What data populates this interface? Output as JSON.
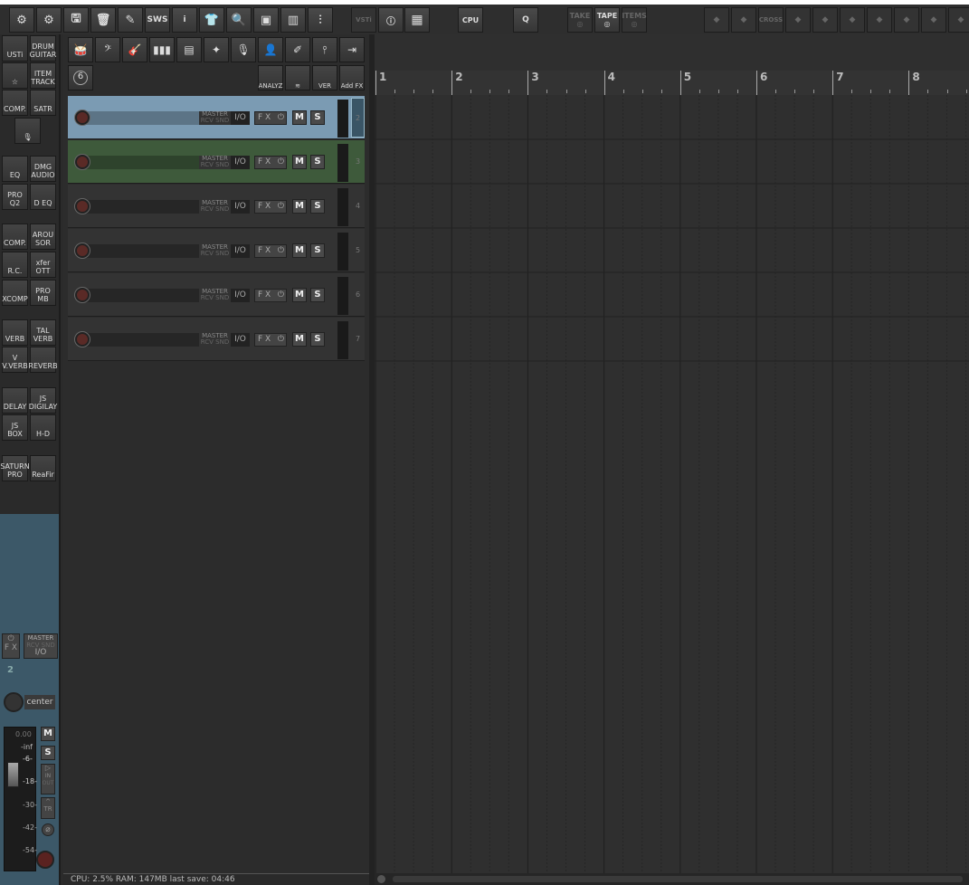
{
  "toolbar": {
    "main": [
      {
        "icon": "preferences-icon"
      },
      {
        "icon": "gear-icon"
      },
      {
        "icon": "save-icon"
      },
      {
        "icon": "trash-icon"
      },
      {
        "icon": "notes-icon"
      },
      {
        "icon": "sws-icon",
        "label": "SWS"
      },
      {
        "icon": "info-icon",
        "label": "i"
      },
      {
        "icon": "theme-icon"
      },
      {
        "icon": "search-icon"
      },
      {
        "icon": "window-icon"
      },
      {
        "icon": "spectrum-icon"
      },
      {
        "icon": "mixer-icon"
      }
    ],
    "vsti_label": "VSTi",
    "cpu_label": "CPU",
    "q_label": "Q",
    "take_label": "TAKE",
    "tape_label": "TAPE",
    "items_label": "ITEMS",
    "cross_label": "CROSS"
  },
  "sidebar": {
    "items": [
      {
        "top": "",
        "bottom": "USTi"
      },
      {
        "top": "DRUM",
        "bottom": "GUITAR"
      },
      {
        "top": "☆",
        "bottom": ""
      },
      {
        "top": "ITEM",
        "bottom": "TRACK"
      },
      {
        "top": "",
        "bottom": "COMP."
      },
      {
        "top": "",
        "bottom": "SATR"
      },
      {
        "top": "🎙",
        "bottom": ""
      },
      {
        "top": "",
        "bottom": "EQ"
      },
      {
        "top": "DMG",
        "bottom": "AUDIO"
      },
      {
        "top": "PRO",
        "bottom": "Q2"
      },
      {
        "top": "",
        "bottom": "D EQ"
      },
      {
        "top": "",
        "bottom": "COMP."
      },
      {
        "top": "AROU",
        "bottom": "SOR"
      },
      {
        "top": "",
        "bottom": "R.C."
      },
      {
        "top": "xfer",
        "bottom": "OTT"
      },
      {
        "top": "",
        "bottom": "XCOMP"
      },
      {
        "top": "PRO",
        "bottom": "MB"
      },
      {
        "top": "",
        "bottom": "VERB"
      },
      {
        "top": "TAL",
        "bottom": "VERB"
      },
      {
        "top": "V",
        "bottom": "V.VERB"
      },
      {
        "top": "",
        "bottom": "REVERB"
      },
      {
        "top": "",
        "bottom": "DELAY"
      },
      {
        "top": "JS",
        "bottom": "DIGILAY"
      },
      {
        "top": "JS",
        "bottom": "BOX"
      },
      {
        "top": "",
        "bottom": "H-D"
      },
      {
        "top": "SATURN",
        "bottom": "PRO"
      },
      {
        "top": "",
        "bottom": "ReaFir"
      }
    ]
  },
  "tcp_toolbar": {
    "icons": [
      "drums-icon",
      "bass-clef-icon",
      "guitar-icon",
      "piano-icon",
      "synth-icon",
      "fx-icon",
      "microphone-icon",
      "person-icon",
      "cable-icon",
      "eq-icon",
      "arrow-right-icon"
    ],
    "six_label": "6",
    "analyz_label": "ANALYZ",
    "ver_label": "VER",
    "addfx_label": "Add FX"
  },
  "tracks": [
    {
      "number": "2",
      "color": "#7b9bb3",
      "master": "MASTER",
      "rcvsnd": "RCV SND",
      "io": "I/O",
      "fx": "F X",
      "mute": "M",
      "solo": "S"
    },
    {
      "number": "3",
      "color": "#3e5a3b",
      "master": "MASTER",
      "rcvsnd": "RCV SND",
      "io": "I/O",
      "fx": "F X",
      "mute": "M",
      "solo": "S"
    },
    {
      "number": "4",
      "color": "#333333",
      "master": "MASTER",
      "rcvsnd": "RCV SND",
      "io": "I/O",
      "fx": "F X",
      "mute": "M",
      "solo": "S"
    },
    {
      "number": "5",
      "color": "#333333",
      "master": "MASTER",
      "rcvsnd": "RCV SND",
      "io": "I/O",
      "fx": "F X",
      "mute": "M",
      "solo": "S"
    },
    {
      "number": "6",
      "color": "#333333",
      "master": "MASTER",
      "rcvsnd": "RCV SND",
      "io": "I/O",
      "fx": "F X",
      "mute": "M",
      "solo": "S"
    },
    {
      "number": "7",
      "color": "#333333",
      "master": "MASTER",
      "rcvsnd": "RCV SND",
      "io": "I/O",
      "fx": "F X",
      "mute": "M",
      "solo": "S"
    }
  ],
  "ruler": {
    "bars": [
      "1",
      "2",
      "3",
      "4",
      "5",
      "6",
      "7",
      "8"
    ]
  },
  "mixer": {
    "fx": "F X",
    "master": "MASTER",
    "rcvsnd": "RCV SND",
    "io": "I/O",
    "track_number": "2",
    "pan": "center",
    "volume": "0.00",
    "peak": "-inf",
    "scale": [
      "-6-",
      "-18-",
      "-30-",
      "-42-",
      "-54-"
    ],
    "mute": "M",
    "solo": "S",
    "in": "IN",
    "out": "OUT",
    "tr": "TR"
  },
  "status": {
    "text": "CPU: 2.5%  RAM: 147MB  last save: 04:46"
  }
}
